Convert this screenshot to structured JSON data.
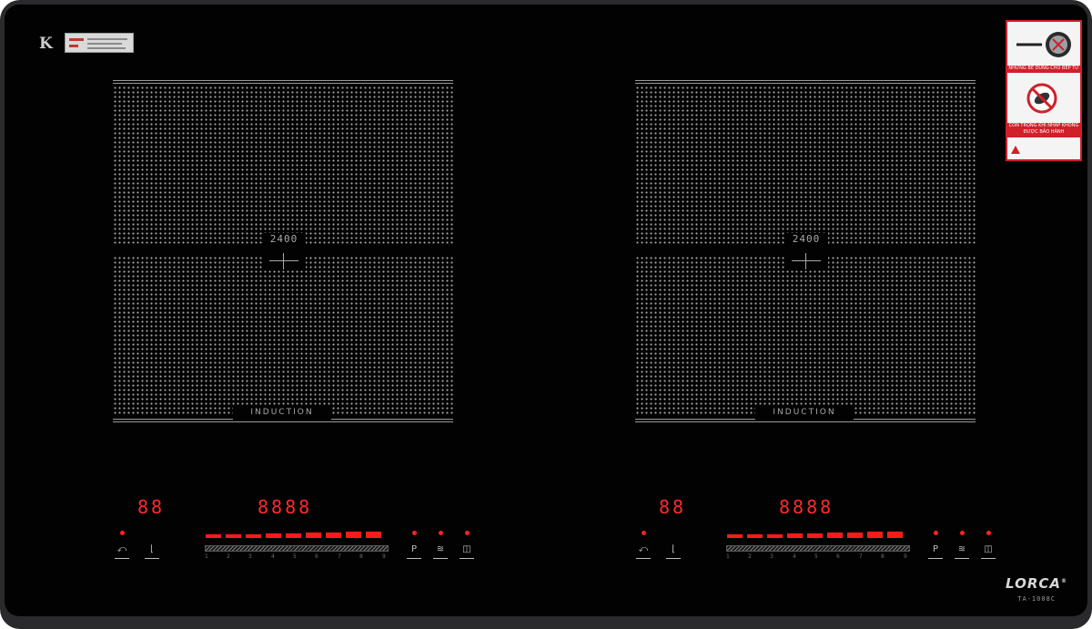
{
  "cooktop": {
    "zones": [
      {
        "power_label": "2400",
        "type_label": "INDUCTION"
      },
      {
        "power_label": "2400",
        "type_label": "INDUCTION"
      }
    ],
    "controls": [
      {
        "timer_display": "88",
        "clock_display": "8888",
        "scale": [
          "1",
          "2",
          "3",
          "4",
          "5",
          "6",
          "7",
          "8",
          "9"
        ]
      },
      {
        "timer_display": "88",
        "clock_display": "8888",
        "scale": [
          "1",
          "2",
          "3",
          "4",
          "5",
          "6",
          "7",
          "8",
          "9"
        ]
      }
    ],
    "brand": "LORCA",
    "model": "TA-1008C",
    "warning_texts": [
      "NHỮNG BỀ DÙNG CHO BẾP TỪ",
      "CÓN TRỌNG KHI NHẤP KHÔNG ĐƯỢC BẢO HÀNH"
    ],
    "colors": {
      "glass": "#020202",
      "frame": "#2a2a2c",
      "led": "#ff2a2a",
      "mesh": "#a8a8a8",
      "warning": "#d0202a"
    }
  }
}
